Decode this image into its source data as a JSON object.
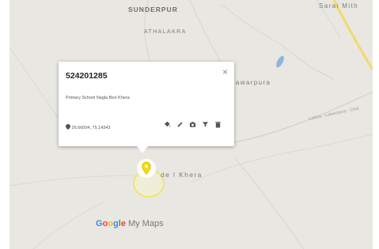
{
  "places": {
    "sunderpur": "SUNDERPUR",
    "athalakra": "ATHALAKRA",
    "sarai_mith": "Sarai Mith",
    "lawarpura": "Lawarpura",
    "khera": "de l Khera"
  },
  "road_labels": {
    "label_1": "Luktna - Lalwerpura - Chat"
  },
  "popup": {
    "title": "524201285",
    "close_glyph": "×",
    "description": "Primary School Nagla Beri Khera",
    "coordinates": "26.66004, 75.14343"
  },
  "branding": {
    "google_letters": [
      "G",
      "o",
      "o",
      "g",
      "l",
      "e"
    ],
    "google_colors": [
      "#4285F4",
      "#EA4335",
      "#FBBC05",
      "#4285F4",
      "#34A853",
      "#EA4335"
    ],
    "my_maps": "My Maps"
  },
  "colors": {
    "marker": "#f5d90f",
    "highlight_ring": "#f3e35a",
    "water": "#8fb4e3",
    "highway": "#f1da6e"
  },
  "icons": [
    "marker-pin-icon",
    "paint-bucket-icon",
    "pencil-icon",
    "camera-icon",
    "filter-icon",
    "trash-icon"
  ]
}
